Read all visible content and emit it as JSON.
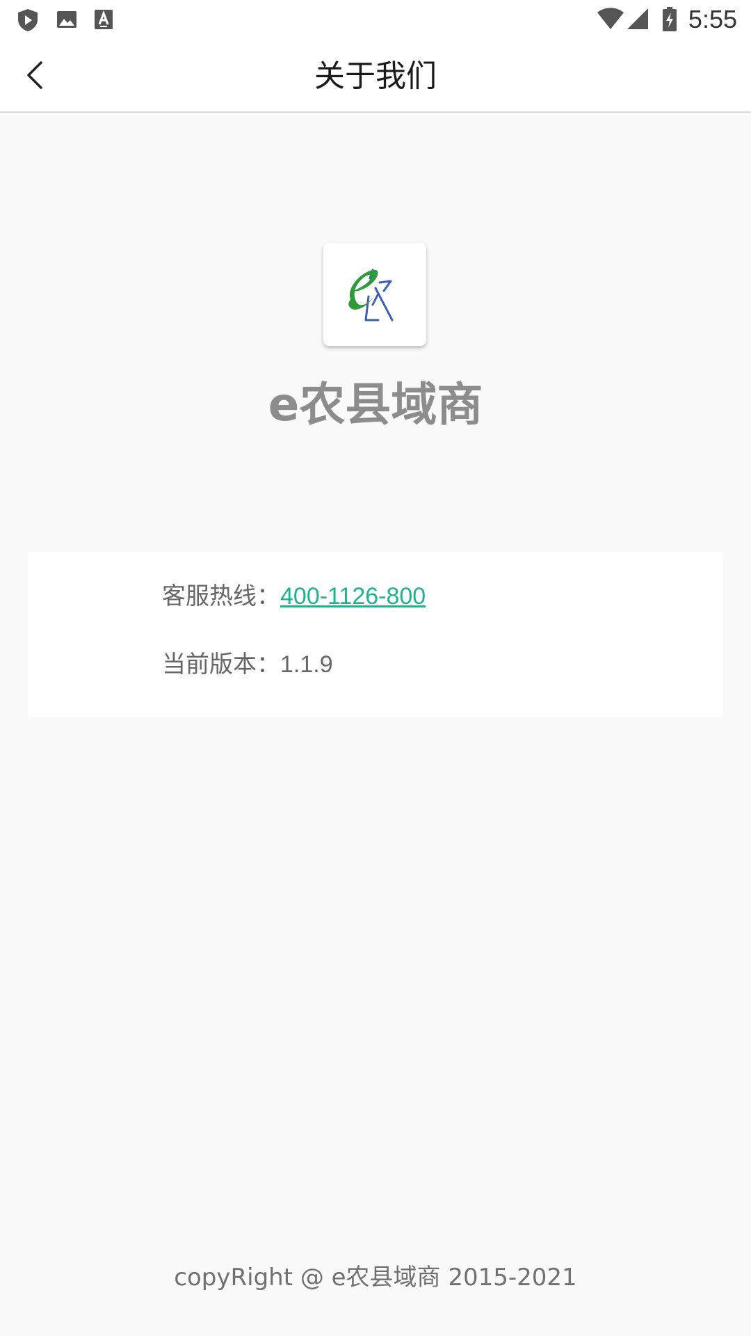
{
  "status_bar": {
    "time": "5:55",
    "left_icons": [
      "shield-play-icon",
      "image-icon",
      "font-a-icon"
    ],
    "right_icons": [
      "wifi-icon",
      "cellular-signal-icon",
      "battery-charging-icon"
    ]
  },
  "header": {
    "title": "关于我们",
    "back_icon": "chevron-left-icon"
  },
  "app": {
    "logo_icon": "app-logo-icon",
    "name": "e农县域商"
  },
  "info": {
    "hotline_label": "客服热线：",
    "hotline_number": "400-1126-800",
    "version_label": "当前版本：",
    "version_value": "1.1.9"
  },
  "footer": {
    "copyright": "copyRight @ e农县域商 2015-2021"
  },
  "colors": {
    "background": "#f9f9f9",
    "link": "#1bb48d",
    "logo_green": "#2e9b3a",
    "logo_blue": "#3f5fb0"
  }
}
